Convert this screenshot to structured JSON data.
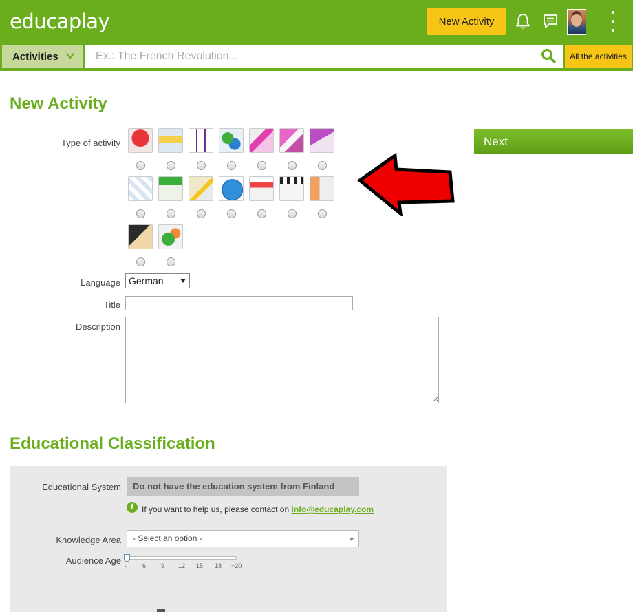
{
  "header": {
    "logo_text": "educaplay",
    "new_activity_label": "New Activity",
    "brand_color": "#6aae1e",
    "accent_color": "#f6c515",
    "icons": [
      "bell-icon",
      "chat-icon",
      "avatar",
      "kebab-menu-icon"
    ]
  },
  "search": {
    "category_label": "Activities",
    "placeholder": "Ex.: The French Revolution...",
    "all_label": "All the activities"
  },
  "new_activity": {
    "heading": "New Activity",
    "type_label": "Type of activity",
    "activity_types": [
      "question-icon",
      "fill-blanks-icon",
      "crossword-icon",
      "matching-icon",
      "dictation-icon",
      "word-search-icon",
      "alphabet-icon",
      "riddle-icon",
      "word-search-grid-icon",
      "relate-icon",
      "map-quiz-icon",
      "slideshow-icon",
      "video-quiz-icon",
      "diagram-icon",
      "image-icon",
      "dialogue-icon"
    ],
    "next_label": "Next",
    "language_label": "Language",
    "language_value": "German",
    "title_label": "Title",
    "description_label": "Description"
  },
  "classification": {
    "heading": "Educational Classification",
    "system_label": "Educational System",
    "system_value": "Do not have the education system from Finland",
    "info_prefix": "If you want to help us, please contact on ",
    "info_email": "info@educaplay.com",
    "knowledge_label": "Knowledge Area",
    "knowledge_value": "- Select an option -",
    "age_label": "Audience Age",
    "age_ticks": [
      "-",
      "6",
      "9",
      "12",
      "15",
      "18",
      "+20"
    ]
  }
}
